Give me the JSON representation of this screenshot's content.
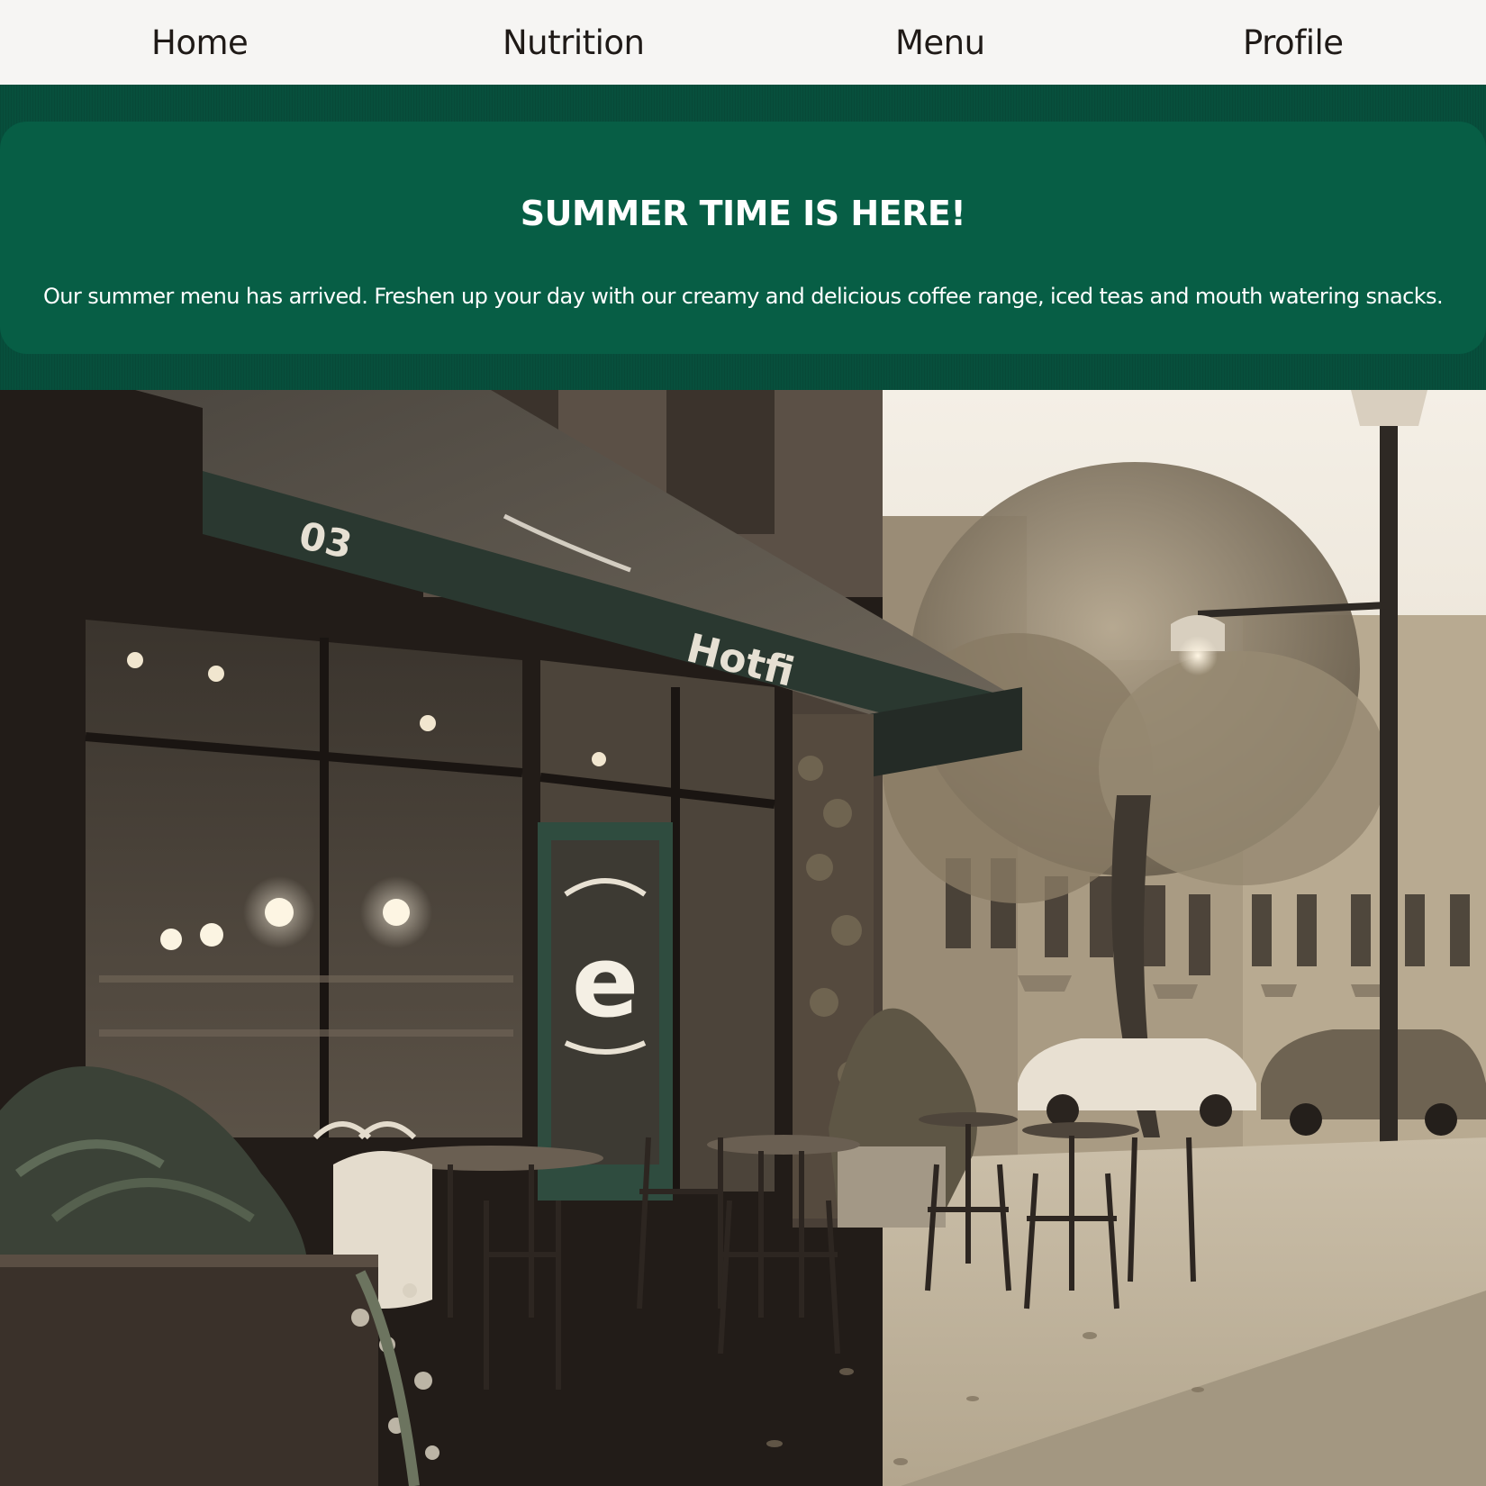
{
  "nav": {
    "items": [
      {
        "label": "Home"
      },
      {
        "label": "Nutrition"
      },
      {
        "label": "Menu"
      },
      {
        "label": "Profile"
      }
    ]
  },
  "promo": {
    "title": "SUMMER TIME IS HERE!",
    "text": "Our summer menu has arrived. Freshen up your day with our creamy and delicious coffee range, iced teas and mouth watering snacks."
  },
  "hero": {
    "awning_text_left": "03",
    "awning_text_mid": "Hotfi",
    "door_logo": "e"
  },
  "colors": {
    "nav_bg": "#f6f5f3",
    "nav_text": "#1f1a17",
    "band_bg": "#074f3c",
    "card_bg": "#075e45",
    "promo_text": "#ffffff",
    "photo_tone": "sepia"
  }
}
